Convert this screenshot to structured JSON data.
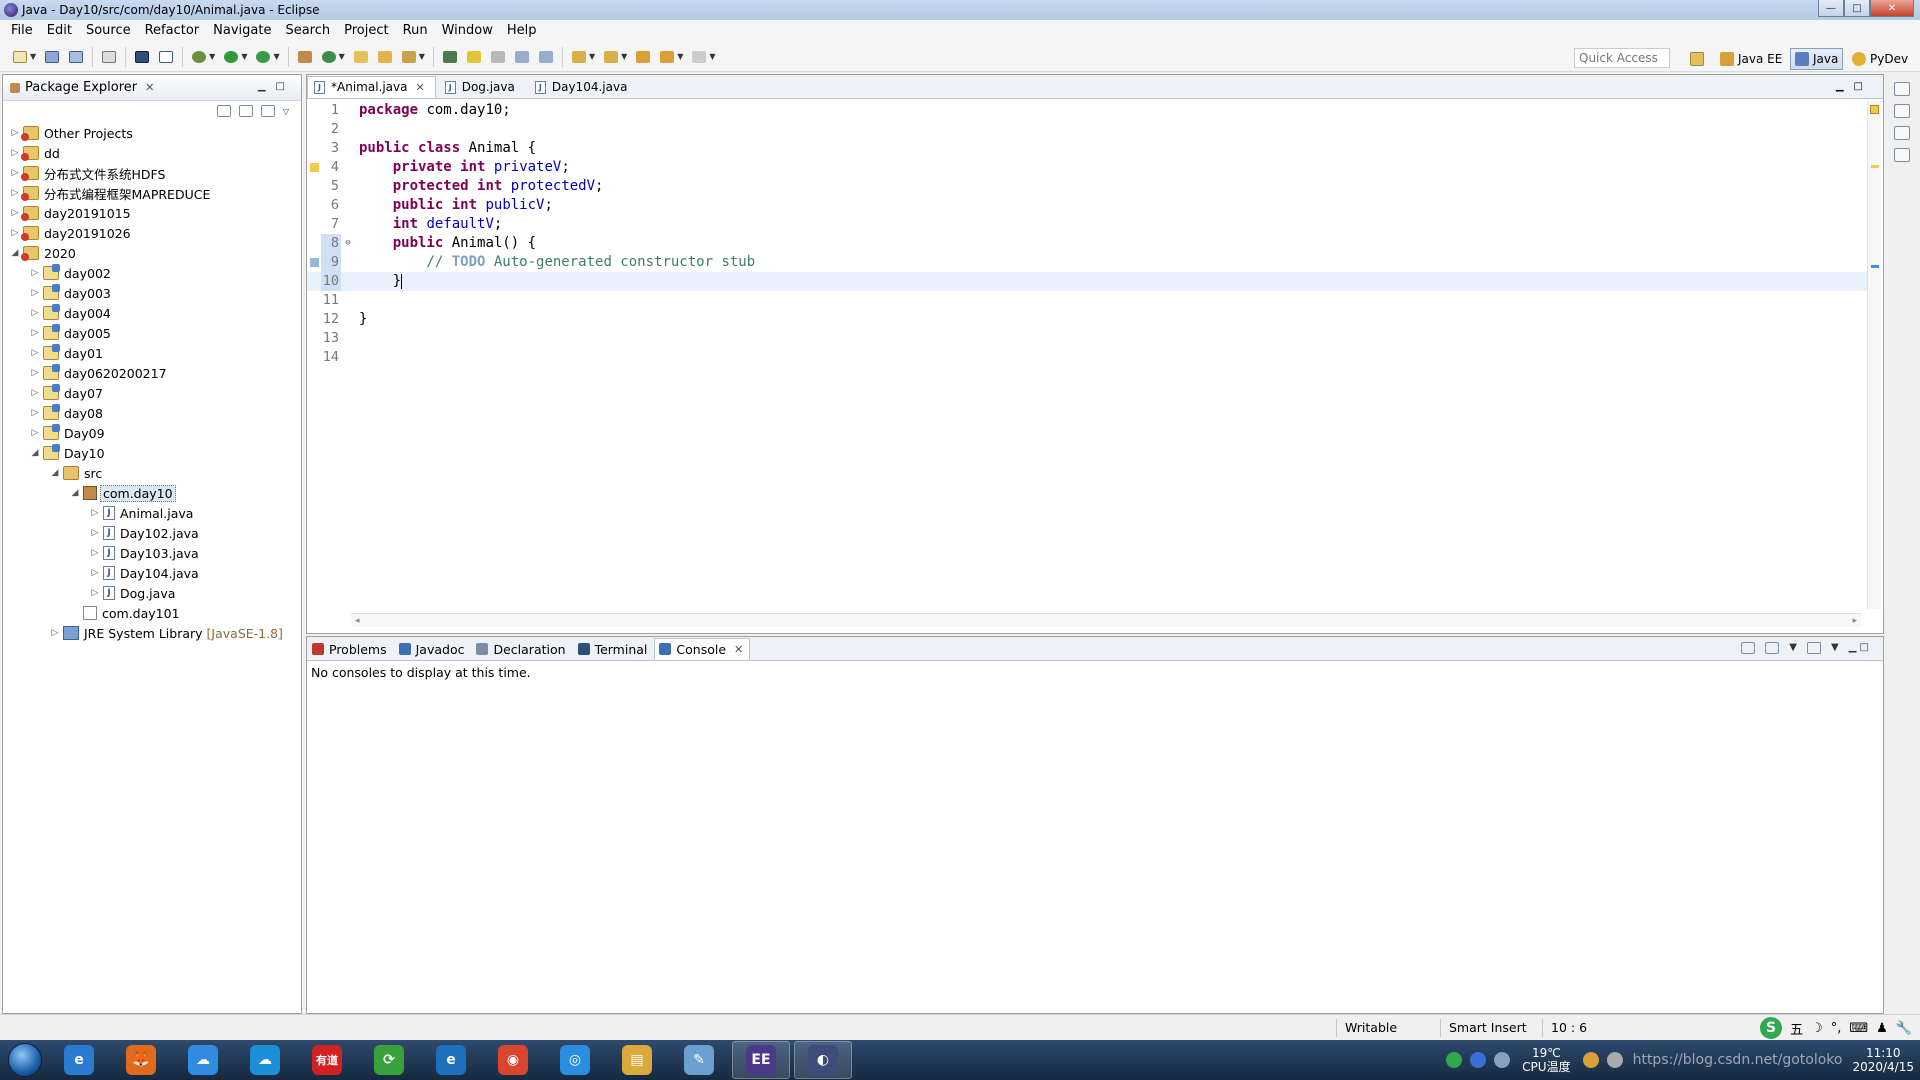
{
  "window": {
    "title": "Java - Day10/src/com/day10/Animal.java - Eclipse",
    "controls": [
      "—",
      "□",
      "✕"
    ]
  },
  "menubar": [
    "File",
    "Edit",
    "Source",
    "Refactor",
    "Navigate",
    "Search",
    "Project",
    "Run",
    "Window",
    "Help"
  ],
  "toolbar": {
    "quick_access_placeholder": "Quick Access",
    "perspectives": [
      "Java EE",
      "Java",
      "PyDev"
    ],
    "active_perspective": "Java"
  },
  "package_explorer": {
    "title": "Package Explorer",
    "tree": [
      {
        "label": "Other Projects",
        "depth": 0,
        "icon": "project-icon",
        "expanded": false
      },
      {
        "label": "dd",
        "depth": 0,
        "icon": "project-icon",
        "expanded": false
      },
      {
        "label": "分布式文件系统HDFS",
        "depth": 0,
        "icon": "project-icon",
        "expanded": false
      },
      {
        "label": "分布式编程框架MAPREDUCE",
        "depth": 0,
        "icon": "project-icon",
        "expanded": false
      },
      {
        "label": "day20191015",
        "depth": 0,
        "icon": "project-icon",
        "expanded": false
      },
      {
        "label": "day20191026",
        "depth": 0,
        "icon": "project-icon",
        "expanded": false
      },
      {
        "label": "2020",
        "depth": 0,
        "icon": "project-icon",
        "expanded": true
      },
      {
        "label": "day002",
        "depth": 1,
        "icon": "java-project-icon",
        "expanded": false
      },
      {
        "label": "day003",
        "depth": 1,
        "icon": "java-project-icon",
        "expanded": false
      },
      {
        "label": "day004",
        "depth": 1,
        "icon": "java-project-icon",
        "expanded": false
      },
      {
        "label": "day005",
        "depth": 1,
        "icon": "java-project-icon",
        "expanded": false
      },
      {
        "label": "day01",
        "depth": 1,
        "icon": "java-project-icon",
        "expanded": false
      },
      {
        "label": "day0620200217",
        "depth": 1,
        "icon": "java-project-icon",
        "expanded": false
      },
      {
        "label": "day07",
        "depth": 1,
        "icon": "java-project-icon",
        "expanded": false
      },
      {
        "label": "day08",
        "depth": 1,
        "icon": "java-project-icon",
        "expanded": false
      },
      {
        "label": "Day09",
        "depth": 1,
        "icon": "java-project-icon",
        "expanded": false
      },
      {
        "label": "Day10",
        "depth": 1,
        "icon": "java-project-icon",
        "expanded": true
      },
      {
        "label": "src",
        "depth": 2,
        "icon": "source-folder-icon",
        "expanded": true
      },
      {
        "label": "com.day10",
        "depth": 3,
        "icon": "package-icon",
        "expanded": true,
        "selected": true
      },
      {
        "label": "Animal.java",
        "depth": 4,
        "icon": "java-file-icon",
        "expanded": false
      },
      {
        "label": "Day102.java",
        "depth": 4,
        "icon": "java-file-icon",
        "expanded": false
      },
      {
        "label": "Day103.java",
        "depth": 4,
        "icon": "java-file-icon",
        "expanded": false
      },
      {
        "label": "Day104.java",
        "depth": 4,
        "icon": "java-file-icon",
        "expanded": false
      },
      {
        "label": "Dog.java",
        "depth": 4,
        "icon": "java-file-icon",
        "expanded": false
      },
      {
        "label": "com.day101",
        "depth": 3,
        "icon": "empty-package-icon",
        "leaf": true
      },
      {
        "label": "JRE System Library",
        "decoration": "[JavaSE-1.8]",
        "depth": 2,
        "icon": "library-icon",
        "expanded": false
      }
    ]
  },
  "editor": {
    "tabs": [
      {
        "label": "*Animal.java",
        "active": true
      },
      {
        "label": "Dog.java",
        "active": false
      },
      {
        "label": "Day104.java",
        "active": false
      }
    ],
    "lines": [
      {
        "n": "1",
        "tokens": [
          [
            "kw",
            "package"
          ],
          [
            "",
            " com.day10;"
          ]
        ]
      },
      {
        "n": "2",
        "tokens": []
      },
      {
        "n": "3",
        "tokens": [
          [
            "kw",
            "public"
          ],
          [
            "",
            " "
          ],
          [
            "kw",
            "class"
          ],
          [
            "",
            " Animal {"
          ]
        ]
      },
      {
        "n": "4",
        "tokens": [
          [
            "",
            "    "
          ],
          [
            "kw",
            "private"
          ],
          [
            "",
            " "
          ],
          [
            "kw",
            "int"
          ],
          [
            "",
            " "
          ],
          [
            "fld",
            "privateV"
          ],
          [
            "",
            ";"
          ]
        ],
        "warning": true
      },
      {
        "n": "5",
        "tokens": [
          [
            "",
            "    "
          ],
          [
            "kw",
            "protected"
          ],
          [
            "",
            " "
          ],
          [
            "kw",
            "int"
          ],
          [
            "",
            " "
          ],
          [
            "fld",
            "protectedV"
          ],
          [
            "",
            ";"
          ]
        ]
      },
      {
        "n": "6",
        "tokens": [
          [
            "",
            "    "
          ],
          [
            "kw",
            "public"
          ],
          [
            "",
            " "
          ],
          [
            "kw",
            "int"
          ],
          [
            "",
            " "
          ],
          [
            "fld",
            "publicV"
          ],
          [
            "",
            ";"
          ]
        ]
      },
      {
        "n": "7",
        "tokens": [
          [
            "",
            "    "
          ],
          [
            "kw",
            "int"
          ],
          [
            "",
            " "
          ],
          [
            "fld",
            "defaultV"
          ],
          [
            "",
            ";"
          ]
        ]
      },
      {
        "n": "8",
        "tokens": [
          [
            "",
            "    "
          ],
          [
            "kw",
            "public"
          ],
          [
            "",
            " Animal() {"
          ]
        ],
        "fold": "⊖"
      },
      {
        "n": "9",
        "tokens": [
          [
            "cm",
            "        // "
          ],
          [
            "todo",
            "TODO"
          ],
          [
            "cm",
            " Auto-generated constructor stub"
          ]
        ],
        "task": true
      },
      {
        "n": "10",
        "tokens": [
          [
            "",
            "    }"
          ]
        ],
        "current": true,
        "caret": true
      },
      {
        "n": "11",
        "tokens": []
      },
      {
        "n": "12",
        "tokens": [
          [
            "",
            "}"
          ]
        ]
      },
      {
        "n": "13",
        "tokens": []
      },
      {
        "n": "14",
        "tokens": []
      }
    ]
  },
  "bottom_panel": {
    "tabs": [
      {
        "label": "Problems",
        "icon": "problems-icon",
        "active": false
      },
      {
        "label": "Javadoc",
        "icon": "javadoc-icon",
        "active": false
      },
      {
        "label": "Declaration",
        "icon": "declaration-icon",
        "active": false
      },
      {
        "label": "Terminal",
        "icon": "terminal-icon",
        "active": false
      },
      {
        "label": "Console",
        "icon": "console-icon",
        "active": true
      }
    ],
    "message": "No consoles to display at this time."
  },
  "statusbar": {
    "writable": "Writable",
    "insert_mode": "Smart Insert",
    "position": "10 : 6",
    "ime_label": "S",
    "ime_mode": "五"
  },
  "taskbar": {
    "apps": [
      {
        "name": "ie-icon",
        "label": "e",
        "color": "#2a7bd1"
      },
      {
        "name": "firefox-icon",
        "label": "🦊",
        "color": "#e06b1c"
      },
      {
        "name": "baidu-netdisk-icon",
        "label": "☁",
        "color": "#2f8ce0"
      },
      {
        "name": "cloud-icon",
        "label": "☁",
        "color": "#1b8fd8"
      },
      {
        "name": "youdao-icon",
        "label": "有道",
        "color": "#d32020"
      },
      {
        "name": "360-icon",
        "label": "⟳",
        "color": "#3aa03a"
      },
      {
        "name": "ie2-icon",
        "label": "e",
        "color": "#1f6fbf"
      },
      {
        "name": "chrome-icon",
        "label": "◉",
        "color": "#d9452f"
      },
      {
        "name": "browser-icon",
        "label": "◎",
        "color": "#2a8ee0"
      },
      {
        "name": "explorer-icon",
        "label": "▤",
        "color": "#d9a93a"
      },
      {
        "name": "notes-icon",
        "label": "✎",
        "color": "#6aa0d0"
      },
      {
        "name": "eclipse-jee-icon",
        "label": "EE",
        "color": "#4b3a8a",
        "active": true
      },
      {
        "name": "eclipse-icon",
        "label": "◐",
        "color": "#3d4c7a",
        "active": true
      }
    ],
    "temperature": "19℃",
    "cpu_label": "CPU温度",
    "time": "11:10",
    "date": "2020/4/15",
    "watermark": "https://blog.csdn.net/gotoloko"
  }
}
